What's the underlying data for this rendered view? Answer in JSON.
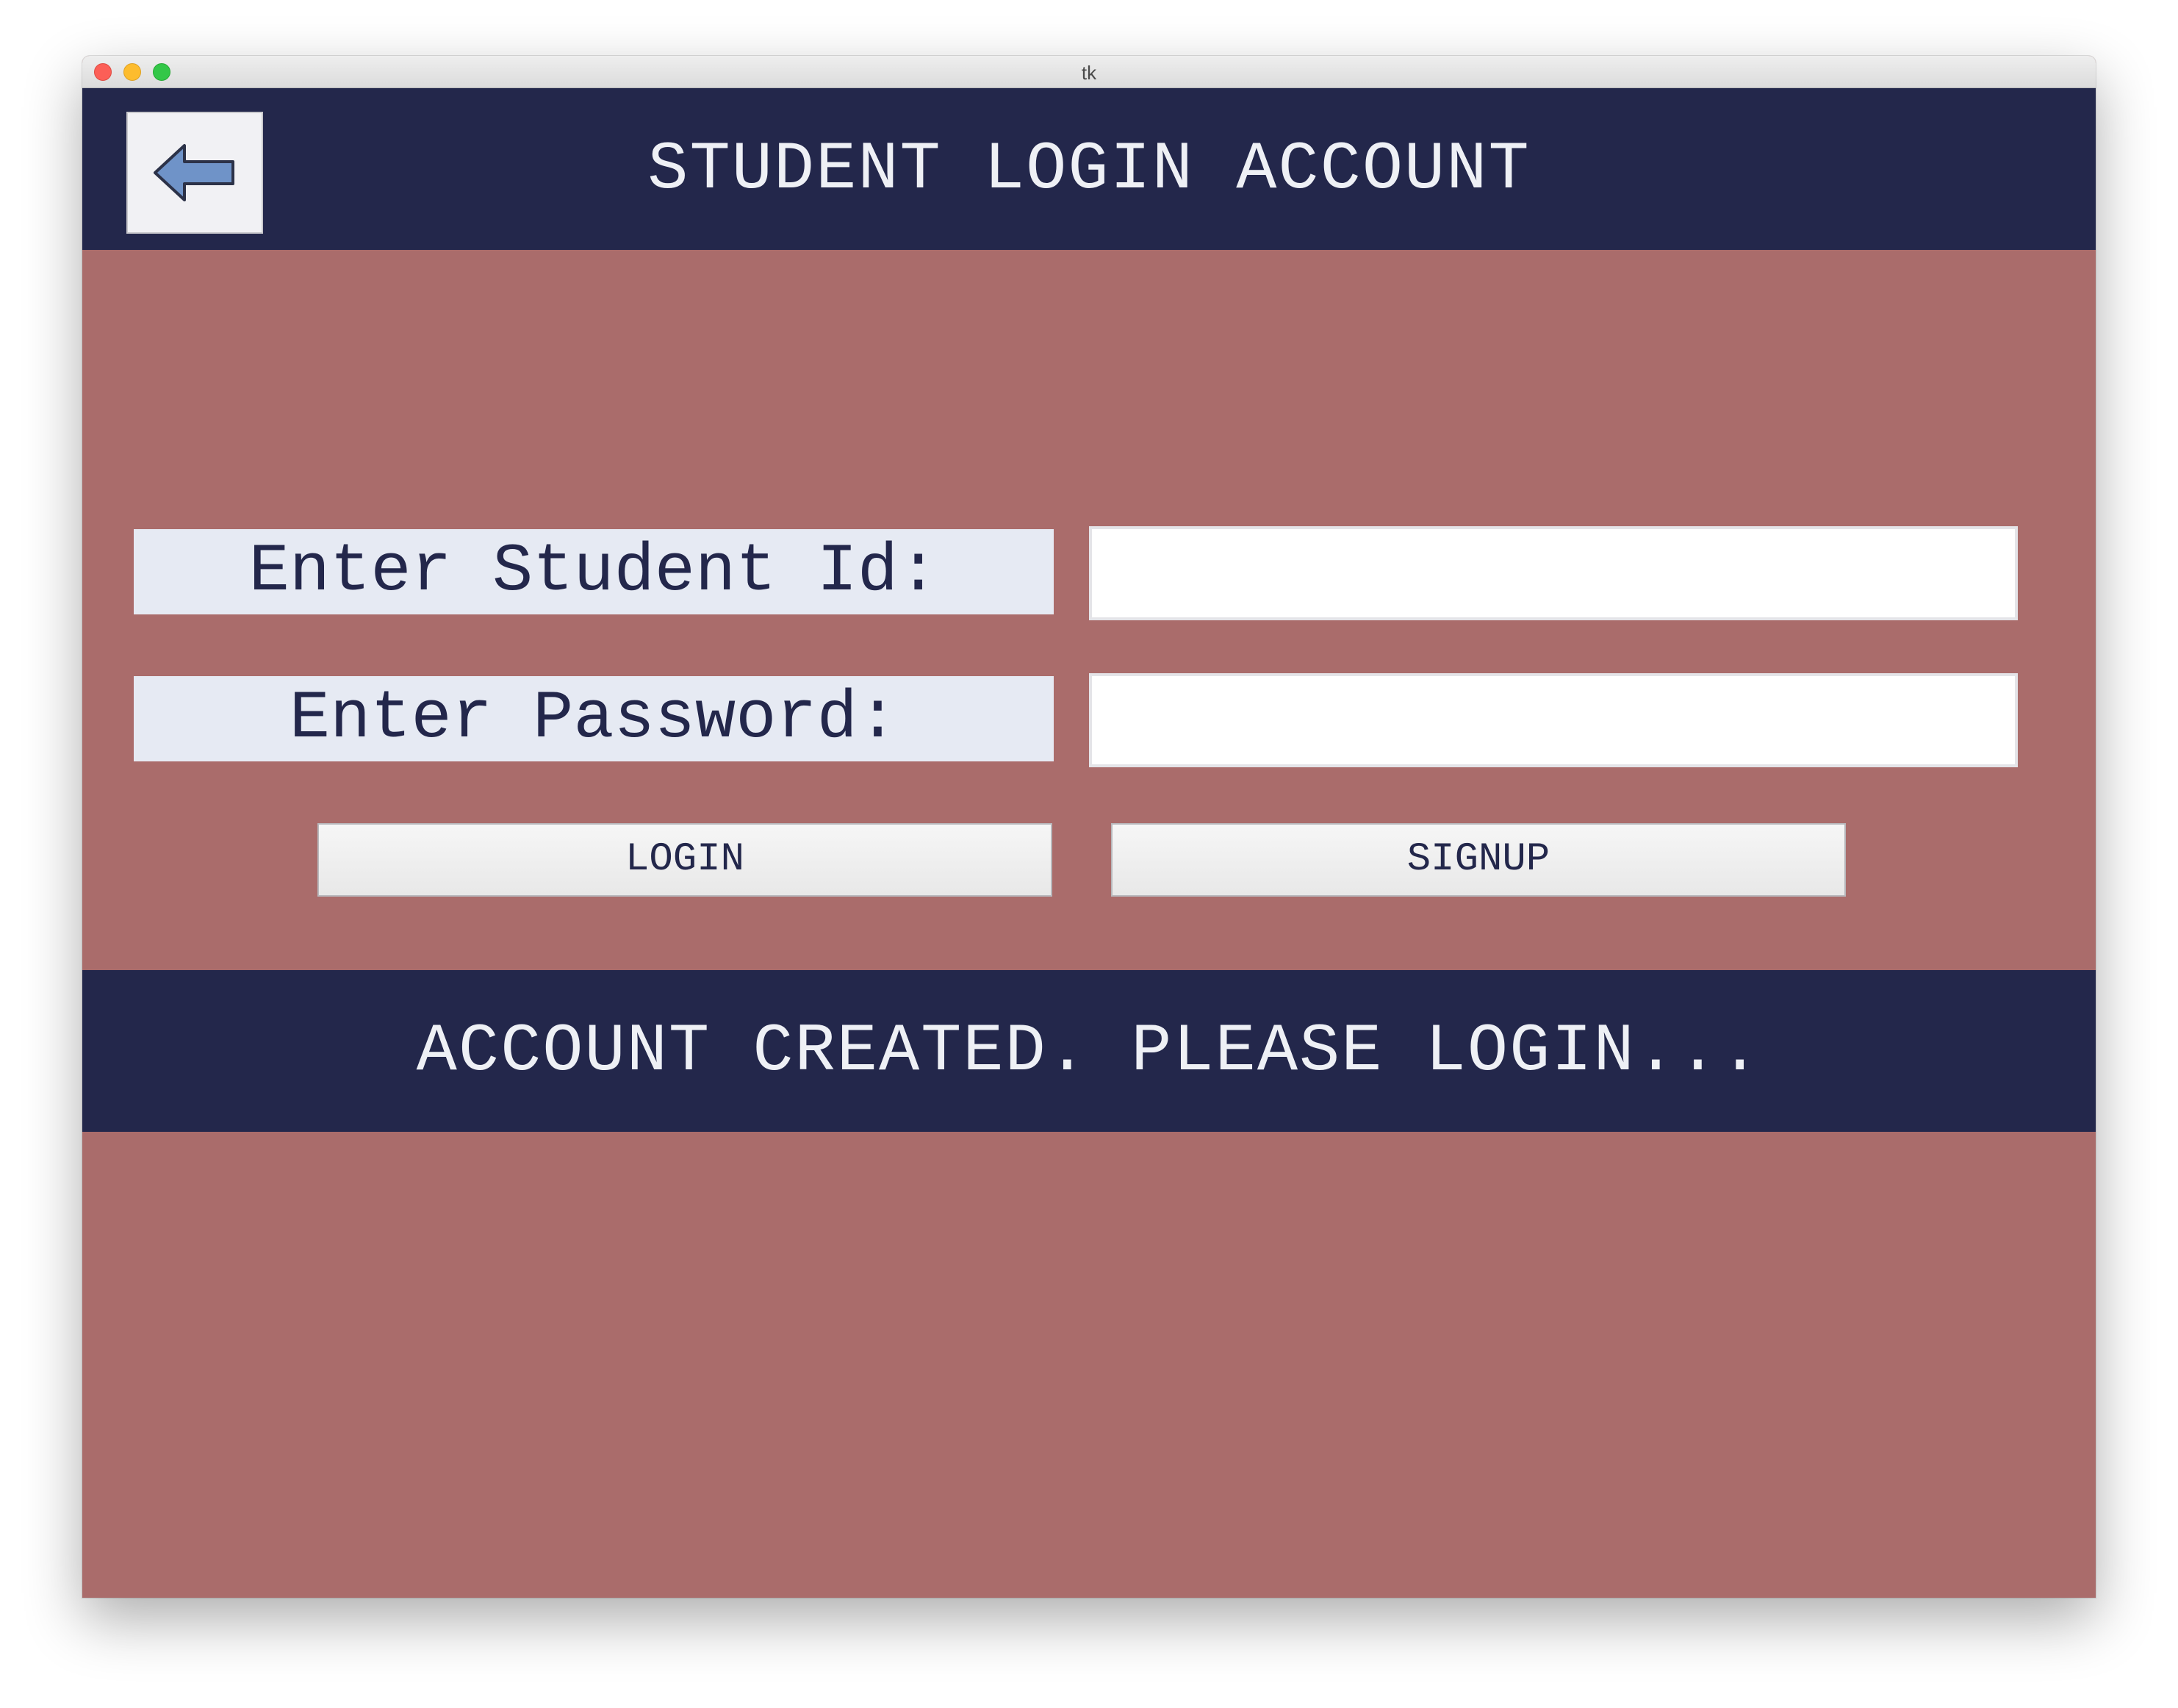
{
  "window": {
    "title": "tk"
  },
  "header": {
    "title": "STUDENT LOGIN ACCOUNT",
    "back_icon": "arrow-left-icon"
  },
  "form": {
    "student_id_label": "Enter Student Id:",
    "student_id_value": "",
    "password_label": "Enter Password:",
    "password_value": ""
  },
  "buttons": {
    "login_label": "LOGIN",
    "signup_label": "SIGNUP"
  },
  "status": {
    "message": "ACCOUNT CREATED. PLEASE LOGIN..."
  },
  "colors": {
    "header_bg": "#23274b",
    "body_bg": "#aa6c6b",
    "label_bg": "#e6eaf3",
    "text_light": "#eef0f5",
    "text_dark": "#23274b",
    "arrow_fill": "#6f93c8"
  }
}
